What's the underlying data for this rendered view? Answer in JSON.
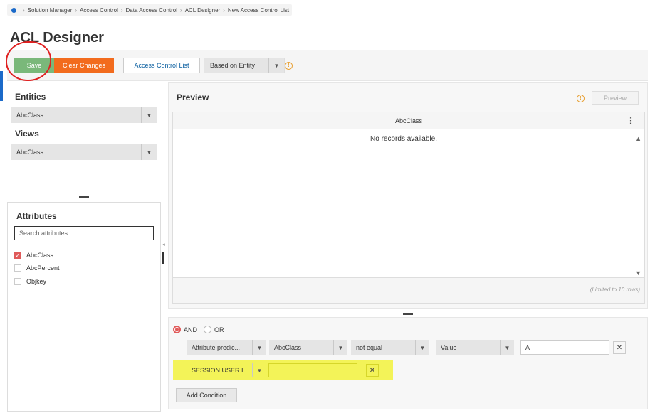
{
  "breadcrumb": [
    "Solution Manager",
    "Access Control",
    "Data Access Control",
    "ACL Designer",
    "New Access Control List"
  ],
  "page_title": "ACL Designer",
  "toolbar": {
    "save_label": "Save",
    "clear_label": "Clear Changes",
    "acl_label": "Access Control List",
    "based_on_value": "Based on Entity"
  },
  "entities": {
    "title": "Entities",
    "value": "AbcClass"
  },
  "views": {
    "title": "Views",
    "value": "AbcClass"
  },
  "attributes": {
    "title": "Attributes",
    "search_placeholder": "Search attributes",
    "items": [
      {
        "label": "AbcClass",
        "checked": true
      },
      {
        "label": "AbcPercent",
        "checked": false
      },
      {
        "label": "Objkey",
        "checked": false
      }
    ]
  },
  "preview": {
    "title": "Preview",
    "button_label": "Preview",
    "column_header": "AbcClass",
    "empty_text": "No records available.",
    "limit_note": "(Limited to 10 rows)"
  },
  "conditions": {
    "and_label": "AND",
    "or_label": "OR",
    "selected_logic": "AND",
    "row1": {
      "type": "Attribute predic...",
      "attribute": "AbcClass",
      "operator": "not equal",
      "value_type": "Value",
      "value": "A"
    },
    "row2": {
      "type": "SESSION USER I...",
      "value": ""
    },
    "add_label": "Add Condition"
  },
  "colors": {
    "save": "#7ab87a",
    "clear": "#f26b1d",
    "accent_blue": "#1b6ac9",
    "checkbox_red": "#e05a5a",
    "highlight": "#f2f23c",
    "annotation_red": "#e02020"
  }
}
